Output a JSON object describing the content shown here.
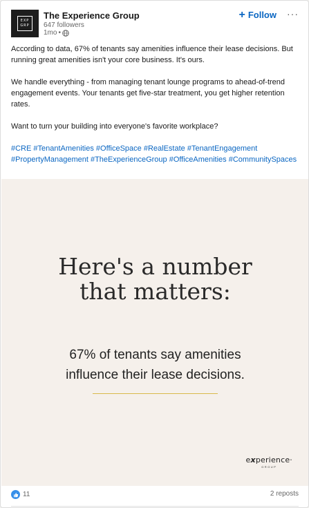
{
  "post": {
    "company_name": "The Experience Group",
    "followers": "647 followers",
    "age": "1mo",
    "meta_sep": "•",
    "follow_label": "Follow",
    "more_label": "···",
    "logo_line1": "EXP",
    "logo_line2": "GRP",
    "paragraphs": [
      "According to data, 67% of tenants say amenities influence their lease decisions. But running great amenities isn't your core business. It's ours.",
      "We handle everything - from managing tenant lounge programs to ahead-of-trend engagement events. Your tenants get five-star treatment, you get higher retention rates.",
      "Want to turn your building into everyone's favorite workplace?"
    ],
    "hashtags": [
      "#CRE",
      "#TenantAmenities",
      "#OfficeSpace",
      "#RealEstate",
      "#TenantEngagement",
      "#PropertyManagement",
      "#TheExperienceGroup",
      "#OfficeAmenities",
      "#CommunitySpaces"
    ]
  },
  "image": {
    "headline_line1": "Here's a number",
    "headline_line2": "that matters:",
    "subline_line1": "67% of tenants say amenities",
    "subline_line2": "influence their lease decisions.",
    "brand_e": "e",
    "brand_x": "x",
    "brand_rest": "perience",
    "brand_tm": "·",
    "brand_sub": "GROUP",
    "accent_color": "#d9b84a",
    "background_color": "#f5f0eb"
  },
  "footer": {
    "reaction_count": "11",
    "reposts": "2 reposts"
  },
  "colors": {
    "link": "#0a66c2",
    "like": "#378fe9"
  }
}
